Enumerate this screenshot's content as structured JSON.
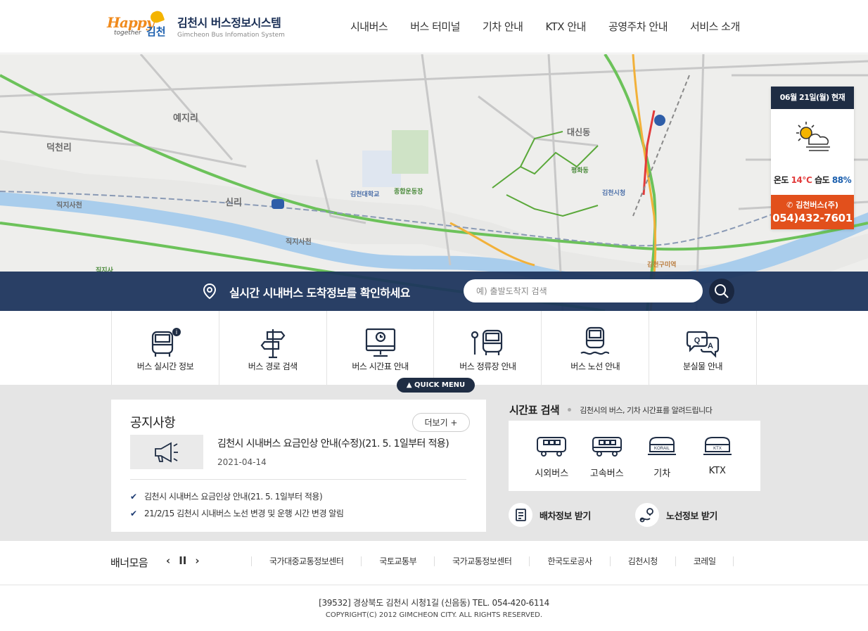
{
  "header": {
    "logo_happy": "Happy",
    "logo_together": "together",
    "logo_city": "김천",
    "title_city": "김천시",
    "title_system": "버스정보시스템",
    "subtitle": "Gimcheon Bus Infomation System",
    "nav": [
      "시내버스",
      "버스 터미널",
      "기차 안내",
      "KTX 안내",
      "공영주차 안내",
      "서비스 소개"
    ]
  },
  "map": {
    "labels": [
      "예지리",
      "덕천리",
      "직지사천",
      "신리",
      "직지사천",
      "대신동",
      "김천대학교",
      "종합운동장",
      "김천시청",
      "평화동",
      "직지사",
      "김천구미역"
    ]
  },
  "weather": {
    "date": "06월 21일(월) 현재",
    "temp_label": "온도",
    "temp": "14℃",
    "humid_label": "습도",
    "humid": "88%",
    "company": "김천버스(주)",
    "phone": "054)432-7601",
    "icon": "cloud-sun-icon"
  },
  "search": {
    "text": "실시간 시내버스 도착정보를 확인하세요",
    "placeholder": "예) 출발도착지 검색"
  },
  "quickmenu": {
    "tab": "▲ QUICK MENU",
    "items": [
      {
        "label": "버스 실시간 정보",
        "icon": "bus-info-icon"
      },
      {
        "label": "버스 경로 검색",
        "icon": "signpost-icon"
      },
      {
        "label": "버스 시간표 안내",
        "icon": "monitor-clock-icon"
      },
      {
        "label": "버스 정류장 안내",
        "icon": "bus-stop-icon"
      },
      {
        "label": "버스 노선 안내",
        "icon": "bus-route-icon"
      },
      {
        "label": "분실물 안내",
        "icon": "qa-bubble-icon"
      }
    ]
  },
  "notice": {
    "title": "공지사항",
    "more": "더보기  +",
    "main_title": "김천시 시내버스 요금인상 안내(수정)(21. 5. 1일부터 적용)",
    "main_date": "2021-04-14",
    "list": [
      "김천시 시내버스 요금인상 안내(21. 5. 1일부터 적용)",
      "21/2/15 김천시 시내버스 노선 변경 및 운행 시간 변경 알림"
    ]
  },
  "timetable": {
    "title": "시간표 검색",
    "desc": "김천시의 버스, 기차 시간표를 알려드립니다",
    "items": [
      {
        "label": "시외버스",
        "icon": "intercity-bus-icon"
      },
      {
        "label": "고속버스",
        "icon": "express-bus-icon"
      },
      {
        "label": "기차",
        "icon": "korail-train-icon"
      },
      {
        "label": "KTX",
        "icon": "ktx-train-icon"
      }
    ],
    "dispatch": "배차정보 받기",
    "route": "노선정보 받기"
  },
  "banner": {
    "title": "배너모음",
    "prev": "‹",
    "pause": "II",
    "next": "›",
    "links": [
      "국가대중교통정보센터",
      "국토교통부",
      "국가교통정보센터",
      "한국도로공사",
      "김천시청",
      "코레일"
    ]
  },
  "footer": {
    "address": "[39532] 경상북도 김천시 시청1길 (신음동) TEL. 054-420-6114",
    "copyright": "COPYRIGHT(C) 2012 GIMCHEON CITY. ALL RIGHTS RESERVED."
  }
}
